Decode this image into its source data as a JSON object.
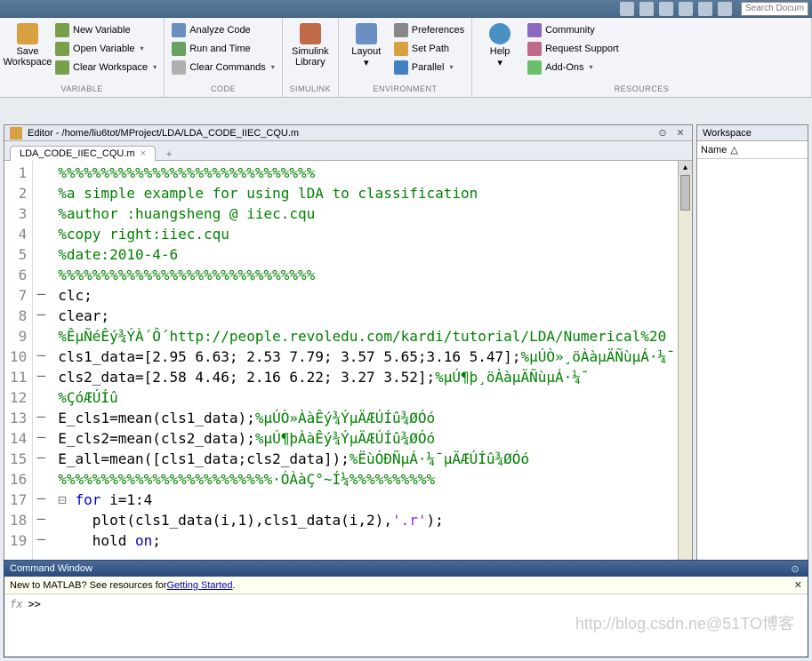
{
  "titlebar": {
    "search_placeholder": "Search Docum"
  },
  "ribbon": {
    "groups": {
      "variable": {
        "caption": "VARIABLE",
        "save": "Save\nWorkspace",
        "new_var": "New Variable",
        "open_var": "Open Variable",
        "clear_ws": "Clear Workspace"
      },
      "code": {
        "caption": "CODE",
        "analyze": "Analyze Code",
        "runtime": "Run and Time",
        "clear_cmd": "Clear Commands"
      },
      "simulink": {
        "caption": "SIMULINK",
        "lib": "Simulink\nLibrary"
      },
      "env": {
        "caption": "ENVIRONMENT",
        "layout": "Layout",
        "prefs": "Preferences",
        "setpath": "Set Path",
        "parallel": "Parallel"
      },
      "res": {
        "caption": "RESOURCES",
        "help": "Help",
        "community": "Community",
        "support": "Request Support",
        "addons": "Add-Ons"
      }
    }
  },
  "editor": {
    "title_prefix": "Editor - ",
    "path": "/home/liu6tot/MProject/LDA/LDA_CODE_IIEC_CQU.m",
    "tab": "LDA_CODE_IIEC_CQU.m",
    "lines": [
      {
        "n": 1,
        "mark": "",
        "cls": "cm-comment",
        "t": "%%%%%%%%%%%%%%%%%%%%%%%%%%%%%%"
      },
      {
        "n": 2,
        "mark": "",
        "cls": "cm-comment",
        "t": "%a simple example for using lDA to classification"
      },
      {
        "n": 3,
        "mark": "",
        "cls": "cm-comment",
        "t": "%author :huangsheng @ iiec.cqu"
      },
      {
        "n": 4,
        "mark": "",
        "cls": "cm-comment",
        "t": "%copy right:iiec.cqu"
      },
      {
        "n": 5,
        "mark": "",
        "cls": "cm-comment",
        "t": "%date:2010-4-6"
      },
      {
        "n": 6,
        "mark": "",
        "cls": "cm-comment",
        "t": "%%%%%%%%%%%%%%%%%%%%%%%%%%%%%%"
      },
      {
        "n": 7,
        "mark": "–",
        "cls": "",
        "t": "clc;"
      },
      {
        "n": 8,
        "mark": "–",
        "cls": "",
        "t": "clear;"
      },
      {
        "n": 9,
        "mark": "",
        "cls": "cm-comment",
        "t": "%ÊµÑéÊý¾ÝÀ´Ô´http://people.revoledu.com/kardi/tutorial/LDA/Numerical%20"
      },
      {
        "n": 10,
        "mark": "–",
        "cls": "",
        "html": "cls1_data=[2.95 6.63; 2.53 7.79; 3.57 5.65;3.16 5.47];<span class='cm-comment'>%µÚÒ»¸öÀàµÄÑùµÁ·¼¯</span>"
      },
      {
        "n": 11,
        "mark": "–",
        "cls": "",
        "html": "cls2_data=[2.58 4.46; 2.16 6.22; 3.27 3.52];<span class='cm-comment'>%µÚ¶þ¸öÀàµÄÑùµÁ·¼¯</span>"
      },
      {
        "n": 12,
        "mark": "",
        "cls": "cm-comment",
        "t": "%ÇóÆÚÍû"
      },
      {
        "n": 13,
        "mark": "–",
        "cls": "",
        "html": "E_cls1=mean(cls1_data);<span class='cm-comment'>%µÚÒ»ÀàÊý¾ÝµÄÆÚÍû¾ØÓó</span>"
      },
      {
        "n": 14,
        "mark": "–",
        "cls": "",
        "html": "E_cls2=mean(cls2_data);<span class='cm-comment'>%µÚ¶þÀàÊý¾ÝµÄÆÚÍû¾ØÓó</span>"
      },
      {
        "n": 15,
        "mark": "–",
        "cls": "",
        "html": "E_all=mean([cls1_data;cls2_data]);<span class='cm-comment'>%ËùÓÐÑµÁ·¼¯µÄÆÚÍû¾ØÓó</span>"
      },
      {
        "n": 16,
        "mark": "",
        "cls": "cm-comment",
        "t": "%%%%%%%%%%%%%%%%%%%%%%%%%·ÓÀàÇ°~Í¼%%%%%%%%%%"
      },
      {
        "n": 17,
        "mark": "–",
        "cls": "",
        "html": "<span class='cm-keyword'>for</span> i=1:4"
      },
      {
        "n": 18,
        "mark": "–",
        "cls": "",
        "html": "    plot(cls1_data(i,1),cls1_data(i,2),<span class='cm-string'>'.r'</span>);"
      },
      {
        "n": 19,
        "mark": "–",
        "cls": "",
        "html": "    hold <span class='cm-keyword'>on</span>;"
      }
    ]
  },
  "workspace": {
    "title": "Workspace",
    "col": "Name"
  },
  "cmd": {
    "title": "Command Window",
    "hint_pre": "New to MATLAB? See resources for ",
    "hint_link": "Getting Started",
    "hint_post": ".",
    "prompt": ">>",
    "fx": "fx"
  },
  "watermark": "http://blog.csdn.ne@51TO博客"
}
